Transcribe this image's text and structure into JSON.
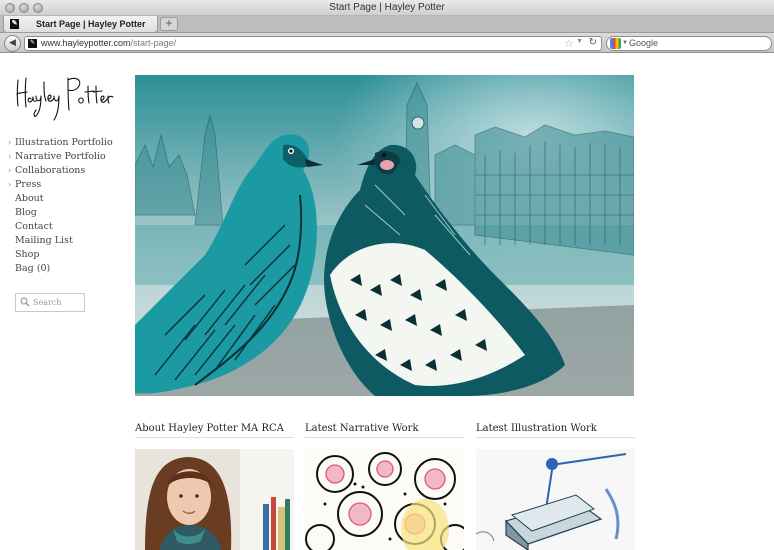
{
  "window": {
    "title": "Start Page | Hayley Potter"
  },
  "tabs": [
    {
      "label": "Start Page | Hayley Potter",
      "active": true
    }
  ],
  "new_tab_label": "+",
  "address": {
    "domain": "www.hayleypotter.com",
    "path": "/start-page/"
  },
  "search": {
    "engine": "Google"
  },
  "site": {
    "logo_text": "Hayley Potter",
    "nav": [
      {
        "label": "Illustration Portfolio",
        "arrow": true
      },
      {
        "label": "Narrative Portfolio",
        "arrow": true
      },
      {
        "label": "Collaborations",
        "arrow": true
      },
      {
        "label": "Press",
        "arrow": true
      },
      {
        "label": "About",
        "arrow": false
      },
      {
        "label": "Blog",
        "arrow": false
      },
      {
        "label": "Contact",
        "arrow": false
      },
      {
        "label": "Mailing List",
        "arrow": false
      },
      {
        "label": "Shop",
        "arrow": false
      },
      {
        "label": "Bag (0)",
        "arrow": false
      }
    ],
    "search_placeholder": "Search",
    "hero_alt": "Watercolour illustration of two pigeons in front of the Westminster skyline",
    "columns": [
      {
        "heading": "About Hayley Potter MA RCA"
      },
      {
        "heading": "Latest Narrative Work"
      },
      {
        "heading": "Latest Illustration Work"
      }
    ]
  },
  "colors": {
    "accent": "#1f9ea5",
    "ink": "#0f3d44",
    "text": "#444444"
  }
}
